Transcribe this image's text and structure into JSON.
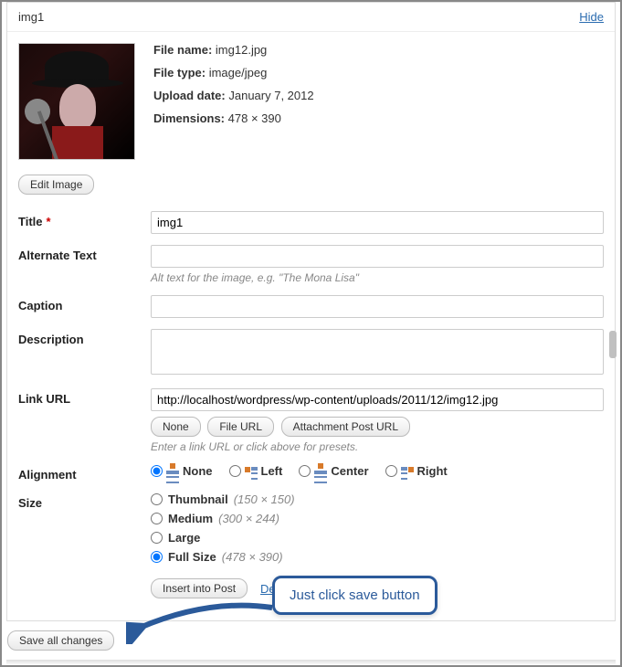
{
  "header": {
    "title": "img1",
    "hide": "Hide"
  },
  "meta": {
    "filename_k": "File name:",
    "filename_v": "img12.jpg",
    "filetype_k": "File type:",
    "filetype_v": "image/jpeg",
    "upload_k": "Upload date:",
    "upload_v": "January 7, 2012",
    "dim_k": "Dimensions:",
    "dim_v": "478 × 390"
  },
  "buttons": {
    "edit_image": "Edit Image",
    "none": "None",
    "file_url": "File URL",
    "att_url": "Attachment Post URL",
    "insert": "Insert into Post",
    "delete": "Delete",
    "save_all": "Save all changes"
  },
  "labels": {
    "title": "Title",
    "alt": "Alternate Text",
    "caption": "Caption",
    "desc": "Description",
    "link": "Link URL",
    "align": "Alignment",
    "size": "Size"
  },
  "hints": {
    "alt": "Alt text for the image, e.g. \"The Mona Lisa\"",
    "link": "Enter a link URL or click above for presets."
  },
  "values": {
    "title": "img1",
    "alt": "",
    "caption": "",
    "desc": "",
    "link": "http://localhost/wordpress/wp-content/uploads/2011/12/img12.jpg"
  },
  "align": {
    "none": "None",
    "left": "Left",
    "center": "Center",
    "right": "Right",
    "selected": "none"
  },
  "size": {
    "thumb": "Thumbnail",
    "thumb_d": "(150 × 150)",
    "med": "Medium",
    "med_d": "(300 × 244)",
    "large": "Large",
    "full": "Full Size",
    "full_d": "(478 × 390)",
    "selected": "full"
  },
  "callout": "Just click  save button"
}
